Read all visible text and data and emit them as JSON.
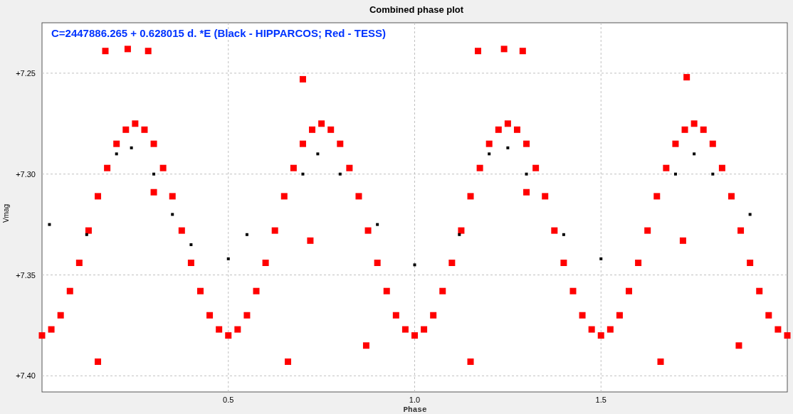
{
  "chart_data": {
    "type": "scatter",
    "title": "Combined phase plot",
    "xlabel": "Phase",
    "ylabel": "Vmag",
    "grid": true,
    "xlim": [
      0,
      2
    ],
    "ylim": [
      7.408,
      7.225
    ],
    "xticks": [
      {
        "value": 0.5,
        "label": "0.5"
      },
      {
        "value": 1.0,
        "label": "1.0"
      },
      {
        "value": 1.5,
        "label": "1.5"
      }
    ],
    "yticks": [
      {
        "value": 7.25,
        "label": "+7.25"
      },
      {
        "value": 7.3,
        "label": "+7.30"
      },
      {
        "value": 7.35,
        "label": "+7.35"
      },
      {
        "value": 7.4,
        "label": "+7.40"
      }
    ],
    "annotations": [
      {
        "text": "C=2447886.265 + 0.628015 d. *E (Black - HIPPARCOS; Red - TESS)"
      }
    ],
    "series": [
      {
        "color": "#ff0000",
        "x": [
          0,
          0.025,
          0.05,
          0.075,
          0.1,
          0.125,
          0.15,
          0.175,
          0.2,
          0.225,
          0.25,
          0.275,
          0.3,
          0.325,
          0.35,
          0.375,
          0.4,
          0.425,
          0.45,
          0.475,
          0.5,
          0.525,
          0.55,
          0.575,
          0.6,
          0.625,
          0.65,
          0.675,
          0.7,
          0.725,
          0.75,
          0.775,
          0.8,
          0.825,
          0.85,
          0.875,
          0.9,
          0.925,
          0.95,
          0.975,
          1.0,
          1.025,
          1.05,
          1.075,
          1.1,
          1.125,
          1.15,
          1.175,
          1.2,
          1.225,
          1.25,
          1.275,
          1.3,
          1.325,
          1.35,
          1.375,
          1.4,
          1.425,
          1.45,
          1.475,
          1.5,
          1.525,
          1.55,
          1.575,
          1.6,
          1.625,
          1.65,
          1.675,
          1.7,
          1.725,
          1.75,
          1.775,
          1.8,
          1.825,
          1.85,
          1.875,
          1.9,
          1.925,
          1.95,
          1.975,
          2.0,
          0.17,
          0.23,
          0.285,
          0.7,
          1.17,
          1.24,
          1.29,
          1.73,
          0.15,
          0.66,
          1.15,
          1.66,
          0.3,
          1.3,
          0.72,
          1.72,
          0.87,
          1.87
        ],
        "values": [
          7.38,
          7.377,
          7.37,
          7.358,
          7.344,
          7.328,
          7.311,
          7.297,
          7.285,
          7.278,
          7.275,
          7.278,
          7.285,
          7.297,
          7.311,
          7.328,
          7.344,
          7.358,
          7.37,
          7.377,
          7.38,
          7.377,
          7.37,
          7.358,
          7.344,
          7.328,
          7.311,
          7.297,
          7.285,
          7.278,
          7.275,
          7.278,
          7.285,
          7.297,
          7.311,
          7.328,
          7.344,
          7.358,
          7.37,
          7.377,
          7.38,
          7.377,
          7.37,
          7.358,
          7.344,
          7.328,
          7.311,
          7.297,
          7.285,
          7.278,
          7.275,
          7.278,
          7.285,
          7.297,
          7.311,
          7.328,
          7.344,
          7.358,
          7.37,
          7.377,
          7.38,
          7.377,
          7.37,
          7.358,
          7.344,
          7.328,
          7.311,
          7.297,
          7.285,
          7.278,
          7.275,
          7.278,
          7.285,
          7.297,
          7.311,
          7.328,
          7.344,
          7.358,
          7.37,
          7.377,
          7.38,
          7.239,
          7.238,
          7.239,
          7.253,
          7.239,
          7.238,
          7.239,
          7.252,
          7.393,
          7.393,
          7.393,
          7.393,
          7.309,
          7.309,
          7.333,
          7.333,
          7.385,
          7.385
        ]
      },
      {
        "color": "#000000",
        "x": [
          0.02,
          0.12,
          0.2,
          0.24,
          0.3,
          0.35,
          0.4,
          0.5,
          0.55,
          0.7,
          0.74,
          0.8,
          0.9,
          1.0,
          1.12,
          1.2,
          1.25,
          1.3,
          1.4,
          1.5,
          1.7,
          1.75,
          1.8,
          1.9
        ],
        "values": [
          7.325,
          7.33,
          7.29,
          7.287,
          7.3,
          7.32,
          7.335,
          7.342,
          7.33,
          7.3,
          7.29,
          7.3,
          7.325,
          7.345,
          7.33,
          7.29,
          7.287,
          7.3,
          7.33,
          7.342,
          7.3,
          7.29,
          7.3,
          7.32
        ]
      }
    ]
  }
}
